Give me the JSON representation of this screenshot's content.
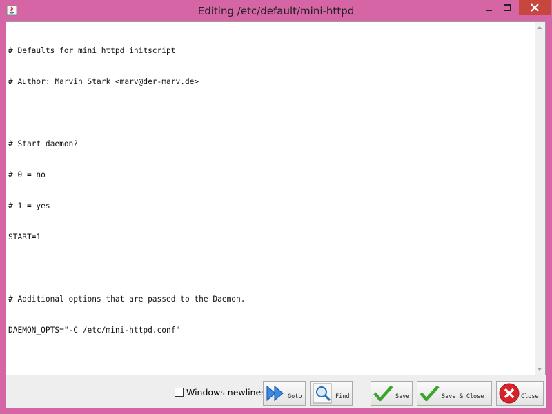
{
  "window": {
    "title": "Editing /etc/default/mini-httpd",
    "min_glyph": "_",
    "max_glyph": "□",
    "close_glyph": "✕"
  },
  "editor": {
    "lines": [
      "# Defaults for mini_httpd initscript",
      "# Author: Marvin Stark <marv@der-marv.de>",
      "",
      "# Start daemon?",
      "# 0 = no",
      "# 1 = yes",
      "START=1",
      "",
      "# Additional options that are passed to the Daemon.",
      "DAEMON_OPTS=\"-C /etc/mini-httpd.conf\""
    ]
  },
  "footer": {
    "windows_newlines_label": "Windows newlines",
    "goto_label": "Goto",
    "find_label": "Find",
    "save_label": "Save",
    "save_close_label": "Save & Close",
    "close_label": "Close"
  },
  "icons": {
    "app": "java-icon",
    "goto": "double-arrow-icon",
    "find": "magnifier-icon",
    "save": "checkmark-icon",
    "save_close": "checkmark-icon",
    "close": "close-x-icon"
  },
  "colors": {
    "frame": "#d565a4",
    "close_button": "#c7473f",
    "goto_arrow": "#1e6fd0",
    "check_green": "#3aa52a",
    "close_red": "#d8232a"
  }
}
